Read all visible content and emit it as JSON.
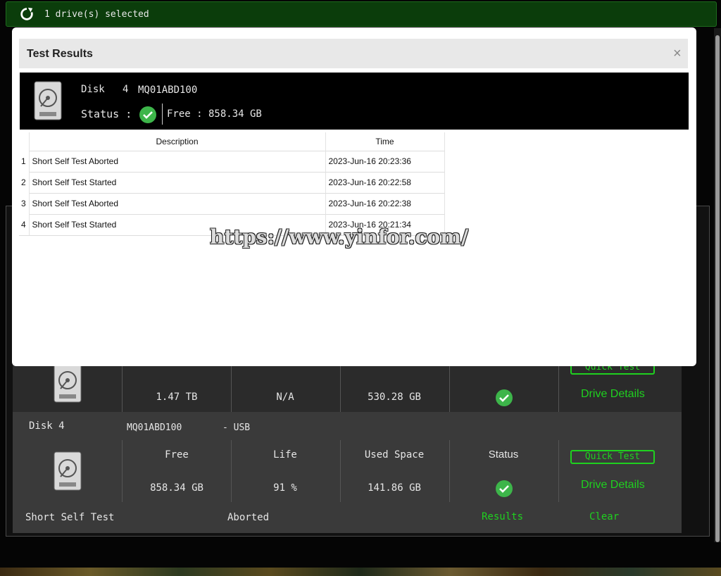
{
  "topbar": {
    "selected_text": "1 drive(s) selected"
  },
  "modal": {
    "title": "Test Results",
    "close": "×",
    "disk_label": "Disk",
    "disk_number": "4",
    "model": "MQ01ABD100",
    "status_label": "Status :",
    "free_text": "Free : 858.34 GB",
    "table": {
      "headers": [
        "Description",
        "Time"
      ],
      "rows": [
        {
          "idx": "1",
          "description": "Short Self Test Aborted",
          "time": "2023-Jun-16 20:23:36"
        },
        {
          "idx": "2",
          "description": "Short Self Test Started",
          "time": "2023-Jun-16 20:22:58"
        },
        {
          "idx": "3",
          "description": "Short Self Test Aborted",
          "time": "2023-Jun-16 20:22:38"
        },
        {
          "idx": "4",
          "description": "Short Self Test Started",
          "time": "2023-Jun-16 20:21:34"
        }
      ]
    }
  },
  "card1": {
    "capacity": "1.47 TB",
    "life": "N/A",
    "used_space": "530.28 GB",
    "quick_test": "Quick Test",
    "drive_details": "Drive Details"
  },
  "card2": {
    "disk_label": "Disk 4",
    "model": "MQ01ABD100",
    "interface": "- USB",
    "headers": {
      "free": "Free",
      "life": "Life",
      "used": "Used Space",
      "status": "Status"
    },
    "free": "858.34 GB",
    "life": "91 %",
    "used_space": "141.86 GB",
    "quick_test": "Quick Test",
    "drive_details": "Drive Details",
    "test_name": "Short Self Test",
    "test_state": "Aborted",
    "results": "Results",
    "clear": "Clear"
  },
  "watermark": "https://www.yinfor.com/",
  "colors": {
    "accent_green": "#1fd11f",
    "status_green": "#3db54a",
    "topbar_green": "#0b3d0b"
  }
}
